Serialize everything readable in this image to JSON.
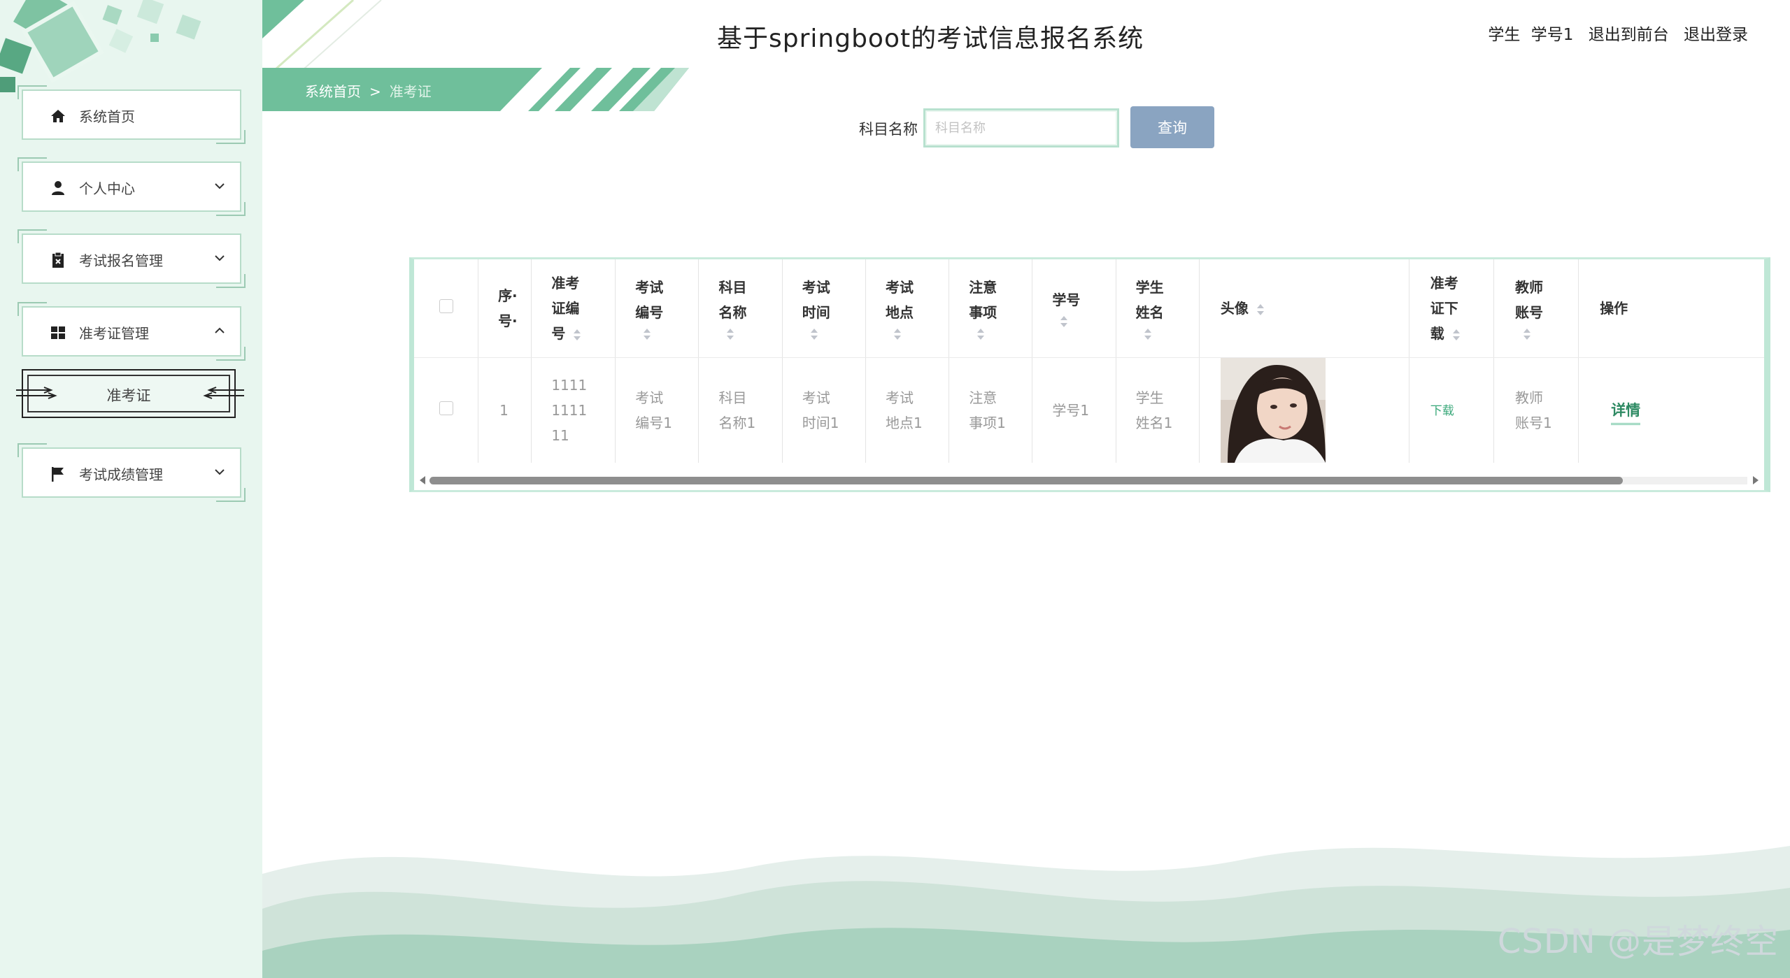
{
  "header": {
    "title": "基于springboot的考试信息报名系统",
    "user_role": "学生",
    "user_name": "学号1",
    "to_frontend": "退出到前台",
    "logout": "退出登录"
  },
  "breadcrumb": {
    "home": "系统首页",
    "separator": ">",
    "current": "准考证"
  },
  "sidebar": {
    "items": [
      {
        "label": "系统首页",
        "icon": "home-icon",
        "expandable": false
      },
      {
        "label": "个人中心",
        "icon": "user-icon",
        "expandable": true,
        "expanded": false
      },
      {
        "label": "考试报名管理",
        "icon": "clipboard-icon",
        "expandable": true,
        "expanded": false
      },
      {
        "label": "准考证管理",
        "icon": "grid-icon",
        "expandable": true,
        "expanded": true
      },
      {
        "label": "考试成绩管理",
        "icon": "flag-icon",
        "expandable": true,
        "expanded": false
      }
    ],
    "sub_item": {
      "label": "准考证",
      "active": true
    }
  },
  "search": {
    "label": "科目名称",
    "placeholder": "科目名称",
    "value": "",
    "button": "查询"
  },
  "table": {
    "headers": [
      {
        "key": "index",
        "lines": [
          "序·",
          "号·"
        ],
        "sortable": false
      },
      {
        "key": "ticket_no",
        "lines": [
          "准考",
          "证编",
          "号"
        ],
        "sortable": true
      },
      {
        "key": "exam_no",
        "lines": [
          "考试",
          "编号"
        ],
        "sortable": true
      },
      {
        "key": "subject",
        "lines": [
          "科目",
          "名称"
        ],
        "sortable": true
      },
      {
        "key": "exam_time",
        "lines": [
          "考试",
          "时间"
        ],
        "sortable": true
      },
      {
        "key": "exam_place",
        "lines": [
          "考试",
          "地点"
        ],
        "sortable": true
      },
      {
        "key": "notes",
        "lines": [
          "注意",
          "事项"
        ],
        "sortable": true
      },
      {
        "key": "student_no",
        "lines": [
          "学号"
        ],
        "sortable": true
      },
      {
        "key": "student_name",
        "lines": [
          "学生",
          "姓名"
        ],
        "sortable": true
      },
      {
        "key": "avatar",
        "lines": [
          "头像"
        ],
        "sortable": true
      },
      {
        "key": "ticket_download",
        "lines": [
          "准考",
          "证下",
          "载"
        ],
        "sortable": true
      },
      {
        "key": "teacher_account",
        "lines": [
          "教师",
          "账号"
        ],
        "sortable": true
      },
      {
        "key": "actions",
        "lines": [
          "操作"
        ],
        "sortable": false
      }
    ],
    "rows": [
      {
        "index": "1",
        "ticket_no": [
          "1111",
          "1111",
          "11"
        ],
        "exam_no": [
          "考试",
          "编号1"
        ],
        "subject": [
          "科目",
          "名称1"
        ],
        "exam_time": [
          "考试",
          "时间1"
        ],
        "exam_place": [
          "考试",
          "地点1"
        ],
        "notes": [
          "注意",
          "事项1"
        ],
        "student_no": [
          "学号1"
        ],
        "student_name": [
          "学生",
          "姓名1"
        ],
        "avatar_icon": "avatar-photo",
        "download": "下载",
        "teacher_account": [
          "教师",
          "账号1"
        ],
        "action": "详情"
      }
    ]
  },
  "watermark": "CSDN @是梦终空",
  "colors": {
    "accent": "#6fbf9b",
    "button": "#8aa4c1",
    "sidebar_bg": "#e8f6ef",
    "link": "#2e8a63"
  }
}
